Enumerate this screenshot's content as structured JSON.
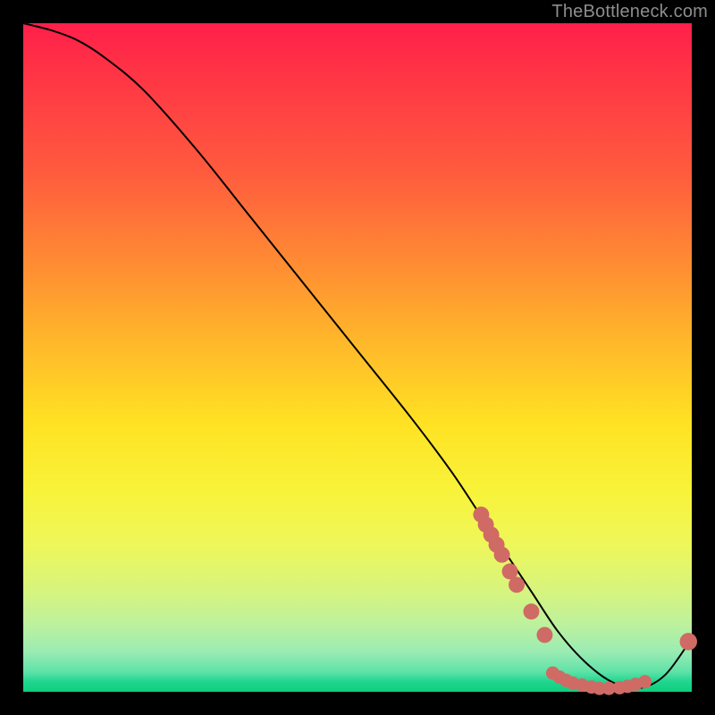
{
  "watermark": "TheBottleneck.com",
  "chart_data": {
    "type": "line",
    "title": "",
    "xlabel": "",
    "ylabel": "",
    "xlim": [
      0,
      100
    ],
    "ylim": [
      0,
      100
    ],
    "grid": false,
    "legend": false,
    "series": [
      {
        "name": "bottleneck-curve",
        "color": "#000000",
        "x": [
          0,
          4,
          8,
          12,
          18,
          26,
          34,
          42,
          50,
          58,
          64,
          68,
          72,
          76,
          80,
          84,
          88,
          92,
          96,
          100
        ],
        "y": [
          100,
          99,
          97.5,
          95,
          90,
          81,
          71,
          61,
          51,
          41,
          33,
          27,
          21,
          15,
          9,
          4.5,
          1.5,
          0.5,
          2.5,
          8
        ]
      }
    ],
    "markers": [
      {
        "x": 68.5,
        "y": 26.5,
        "r": 1.2
      },
      {
        "x": 69.2,
        "y": 25.0,
        "r": 1.2
      },
      {
        "x": 70.0,
        "y": 23.5,
        "r": 1.2
      },
      {
        "x": 70.8,
        "y": 22.0,
        "r": 1.2
      },
      {
        "x": 71.6,
        "y": 20.5,
        "r": 1.2
      },
      {
        "x": 72.8,
        "y": 18.0,
        "r": 1.2
      },
      {
        "x": 73.8,
        "y": 16.0,
        "r": 1.2
      },
      {
        "x": 76.0,
        "y": 12.0,
        "r": 1.2
      },
      {
        "x": 78.0,
        "y": 8.5,
        "r": 1.2
      },
      {
        "x": 79.2,
        "y": 2.8,
        "r": 1.0
      },
      {
        "x": 80.2,
        "y": 2.2,
        "r": 1.0
      },
      {
        "x": 81.2,
        "y": 1.7,
        "r": 1.0
      },
      {
        "x": 82.2,
        "y": 1.3,
        "r": 1.0
      },
      {
        "x": 83.6,
        "y": 1.0,
        "r": 1.0
      },
      {
        "x": 85.0,
        "y": 0.7,
        "r": 1.0
      },
      {
        "x": 86.2,
        "y": 0.5,
        "r": 1.0
      },
      {
        "x": 87.6,
        "y": 0.5,
        "r": 1.0
      },
      {
        "x": 89.2,
        "y": 0.6,
        "r": 1.0
      },
      {
        "x": 90.4,
        "y": 0.8,
        "r": 1.0
      },
      {
        "x": 91.6,
        "y": 1.1,
        "r": 1.0
      },
      {
        "x": 93.0,
        "y": 1.5,
        "r": 1.0
      },
      {
        "x": 99.5,
        "y": 7.5,
        "r": 1.3
      }
    ],
    "marker_color": "#d06a64"
  }
}
